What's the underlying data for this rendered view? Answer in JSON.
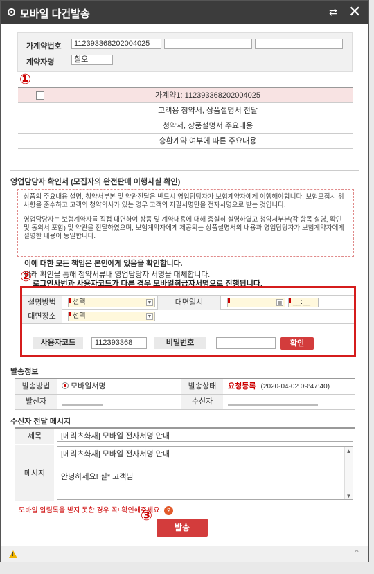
{
  "window": {
    "title": "모바일 다건발송",
    "refresh_icon": "⇄",
    "close_icon": "✕"
  },
  "contract_info": {
    "contract_no_label": "가계약번호",
    "contract_no_value": "112393368202004025",
    "contract_no_extra1": "",
    "contract_no_extra2": "",
    "contractor_label": "계약자명",
    "contractor_value": "칠오"
  },
  "markers": {
    "m1": "①",
    "m2": "②",
    "m3": "③"
  },
  "documents": [
    {
      "label": "가계약1: 112393368202004025",
      "checked": false
    },
    {
      "label": "고객용 청약서, 상품설명서 전달"
    },
    {
      "label": "청약서, 상품설명서 주요내용"
    },
    {
      "label": "승환계약 여부에 따른 주요내용"
    }
  ],
  "sales_confirm": {
    "title": "영업담당자 확인서 (모집자의 완전판매 이행사실 확인)",
    "para1": "상품의 주요내용 설명, 청약서부본 및 약관전달은 반드시 영업담당자가 보험계약자에게 이행해야합니다. 보험모집시 위 사항을 준수하고 고객의 청약의사가 있는 경우 고객의 자필서명만을 전자서명으로 받는 것입니다.",
    "para2": "영업담당자는 보험계약자를 직접 대면하여 상품 및 계약내용에 대해 충실히 설명하였고 청약서부본(각 항목 설명, 확인 및 동의서 포함) 및 약관을 전달하였으며, 보험계약자에게 제공되는 상품설명서의 내용과 영업담당자가 보험계약자에게 설명한 내용이 동일합니다.",
    "para3a": "이에 대한 모든 책임은 본인에게 있음을 확인합니다.",
    "para3b": "아래 확인을 통해 청약서류내 영업담당자 서명을 대체합니다.",
    "warning": "로그인사번과 사용자코드가 다른 경우 모바일취급자서명으로 진행됩니다."
  },
  "auth": {
    "method_label": "설명방법",
    "method_value": "선택",
    "date_label": "대면일시",
    "date_value": "",
    "time_value": "__:__",
    "place_label": "대면장소",
    "place_value": "선택",
    "usercode_label": "사용자코드",
    "usercode_value": "112393368",
    "password_label": "비밀번호",
    "password_value": "",
    "confirm_button": "확인"
  },
  "send_info": {
    "title": "발송정보",
    "method_label": "발송방법",
    "method_value": "모바일서명",
    "status_label": "발송상태",
    "status_value": "요청등록",
    "status_time": "(2020-04-02 09:47:40)",
    "sender_label": "발신자",
    "receiver_label": "수신자"
  },
  "message": {
    "title": "수신자 전달 메시지",
    "subject_label": "제목",
    "subject_value": "[메리츠화재] 모바일 전자서명 안내",
    "body_label": "메시지",
    "body_line1": "[메리츠화재] 모바일 전자서명 안내",
    "body_line2": "안녕하세요! 칠* 고객님",
    "note": "모바일 알림톡을 받지 못한 경우 꼭! 확인해주세요."
  },
  "send_button": "발송",
  "colors": {
    "accent_red": "#d33c3c",
    "highlight_box": "#d51c1c",
    "titlebar": "#3c3c3c"
  }
}
